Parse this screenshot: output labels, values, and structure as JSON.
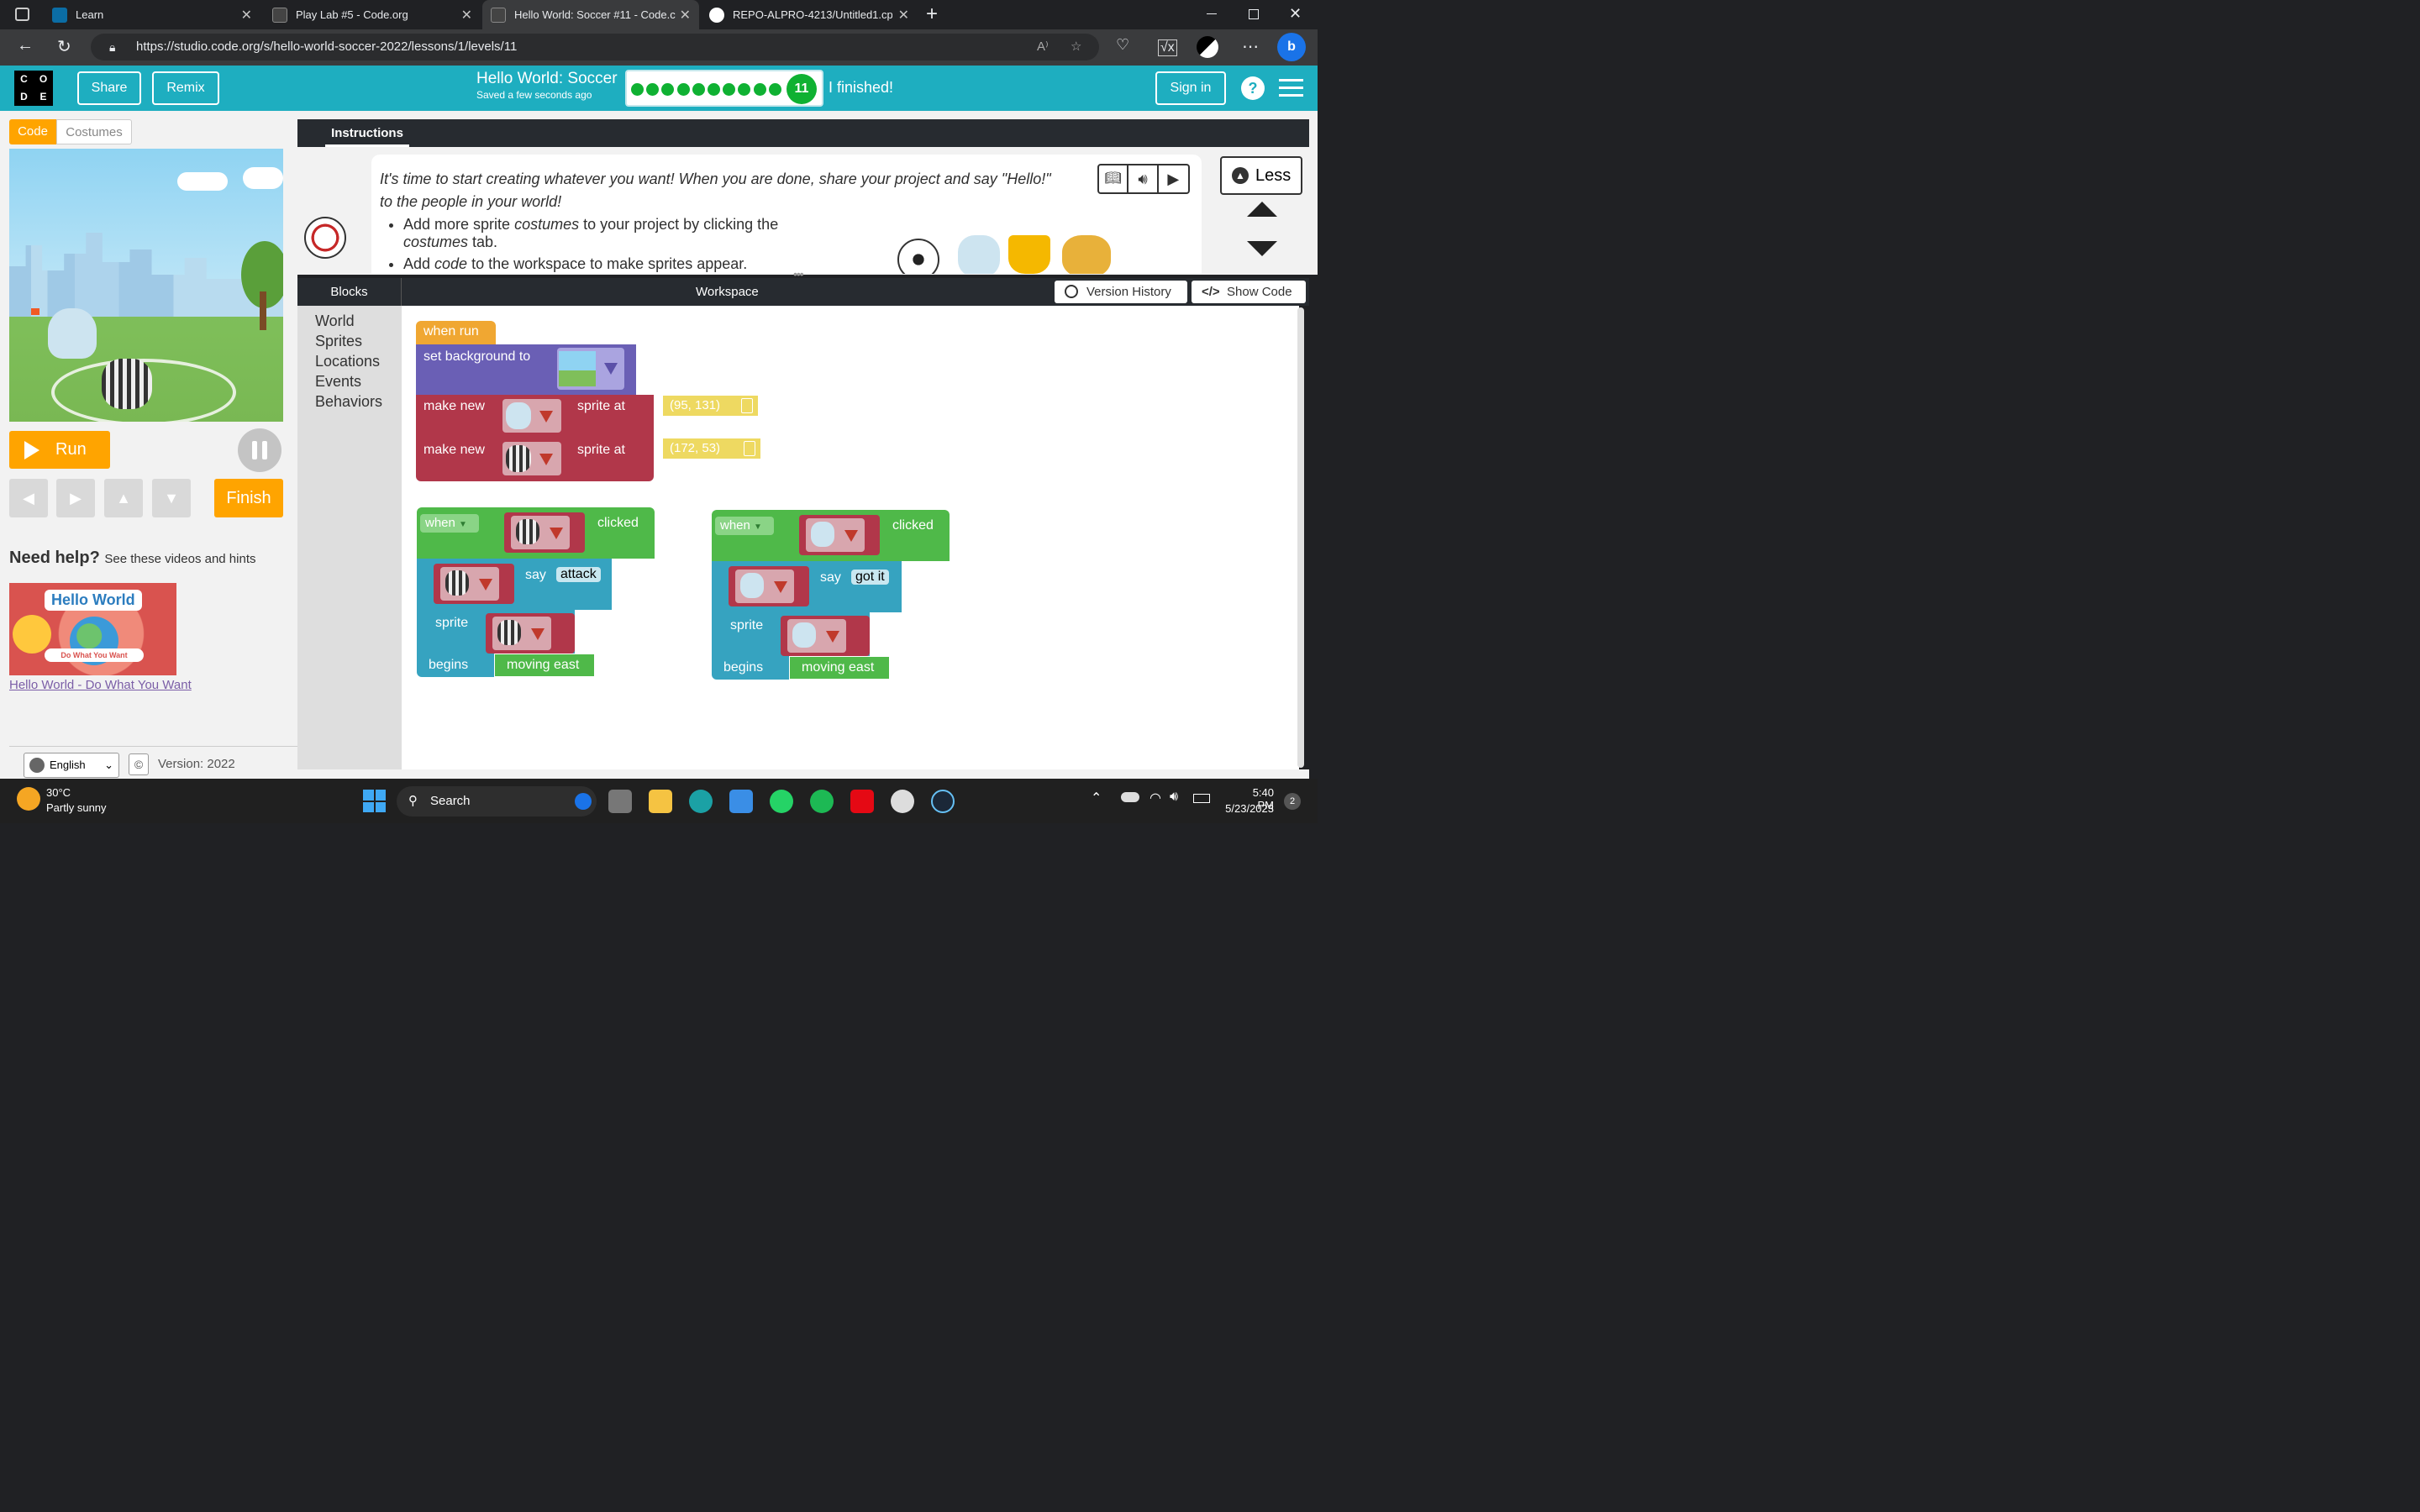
{
  "browser": {
    "tabs": [
      {
        "title": "Learn"
      },
      {
        "title": "Play Lab #5 - Code.org"
      },
      {
        "title": "Hello World: Soccer #11 - Code.c"
      },
      {
        "title": "REPO-ALPRO-4213/Untitled1.cp"
      }
    ],
    "url": "https://studio.code.org/s/hello-world-soccer-2022/lessons/1/levels/11"
  },
  "header": {
    "logo_letters": [
      "C",
      "O",
      "D",
      "E"
    ],
    "share_label": "Share",
    "remix_label": "Remix",
    "title": "Hello World: Soccer",
    "saved_text": "Saved a few seconds ago",
    "level_number": "11",
    "completed_dots": 10,
    "finished_text": "I finished!",
    "sign_in_label": "Sign in",
    "help_label": "?"
  },
  "left": {
    "code_tab": "Code",
    "costumes_tab": "Costumes",
    "run_label": "Run",
    "finish_label": "Finish",
    "need_help": "Need help?",
    "need_help_sub": "See these videos and hints",
    "video_title": "Hello World",
    "video_subtitle": "Do What You Want",
    "video_link": "Hello World - Do What You Want",
    "language": "English",
    "copyright": "©",
    "version": "Version: 2022"
  },
  "instructions": {
    "tab_label": "Instructions",
    "line1": "It's time to start creating whatever you want! When you are done, share your project and say \"Hello!\" to the people in your world!",
    "bullet1_a": "Add more sprite ",
    "bullet1_em": "costumes",
    "bullet1_b": " to your project by clicking the",
    "bullet1_em2": "costumes",
    "bullet1_c": " tab.",
    "bullet2_a": "Add ",
    "bullet2_em": "code",
    "bullet2_b": " to the workspace to make sprites appear.",
    "less_label": "Less"
  },
  "workspace": {
    "blocks_header": "Blocks",
    "workspace_header": "Workspace",
    "version_history": "Version History",
    "show_code": "Show Code",
    "categories": [
      "World",
      "Sprites",
      "Locations",
      "Events",
      "Behaviors"
    ],
    "when_run": "when run",
    "set_background": "set background to",
    "make_new": "make new",
    "sprite_at": "sprite at",
    "coord1": "(95, 131)",
    "coord2": "(172, 53)",
    "when": "when",
    "clicked": "clicked",
    "say": "say",
    "say1": "attack",
    "say2": "got it",
    "sprite": "sprite",
    "begins": "begins",
    "behavior": "moving east"
  },
  "taskbar": {
    "temp": "30°C",
    "weather": "Partly sunny",
    "search": "Search",
    "time": "5:40 PM",
    "date": "5/23/2023",
    "notif_count": "2"
  }
}
